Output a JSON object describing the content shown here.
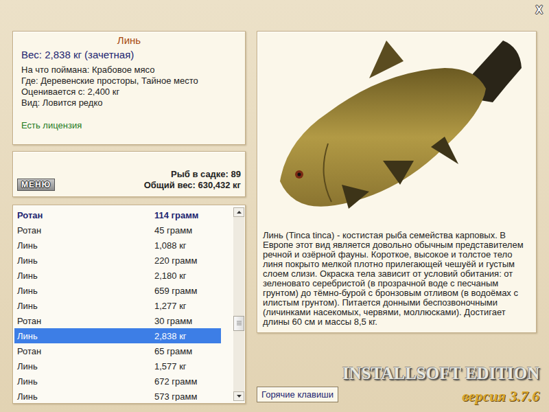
{
  "window": {
    "close": "X"
  },
  "fish": {
    "name": "Линь",
    "weight": "Вес: 2,838 кг (зачетная)",
    "details": [
      "На что поймана: Крабовое мясо",
      "Где: Деревенские просторы, Тайное место",
      "Оценивается с: 2,400 кг",
      "Вид: Ловится редко"
    ],
    "license": "Есть лицензия",
    "description": "Линь (Tinca tinca) - костистая рыба семейства карповых. В Европе этот вид является довольно обычным представителем речной и озёрной фауны. Короткое, высокое и толстое тело линя покрыто мелкой плотно прилегающей чешуёй и густым слоем слизи. Окраска тела зависит от условий обитания: от зеленовато серебристой (в прозрачной воде с песчаным грунтом) до тёмно-бурой с бронзовым отливом (в водоёмах с илистым грунтом). Питается донными беспозвоночными (личинками насекомых, червями, моллюсками). Достигает длины 60 см и массы 8,5 кг."
  },
  "menu_button": "МЕНЮ",
  "keepnet": {
    "count": "Рыб в садке: 89",
    "total": "Общий вес: 630,432 кг"
  },
  "catch_list": {
    "rows": [
      {
        "name": "Ротан",
        "weight": "114 грамм",
        "emphasized": true,
        "selected": false
      },
      {
        "name": "Ротан",
        "weight": "45 грамм",
        "emphasized": false,
        "selected": false
      },
      {
        "name": "Линь",
        "weight": "1,088 кг",
        "emphasized": false,
        "selected": false
      },
      {
        "name": "Линь",
        "weight": "220 грамм",
        "emphasized": false,
        "selected": false
      },
      {
        "name": "Линь",
        "weight": "2,180 кг",
        "emphasized": false,
        "selected": false
      },
      {
        "name": "Линь",
        "weight": "659 грамм",
        "emphasized": false,
        "selected": false
      },
      {
        "name": "Линь",
        "weight": "1,277 кг",
        "emphasized": false,
        "selected": false
      },
      {
        "name": "Ротан",
        "weight": "30 грамм",
        "emphasized": false,
        "selected": false
      },
      {
        "name": "Линь",
        "weight": "2,838 кг",
        "emphasized": false,
        "selected": true
      },
      {
        "name": "Ротан",
        "weight": "65 грамм",
        "emphasized": false,
        "selected": false
      },
      {
        "name": "Линь",
        "weight": "1,577 кг",
        "emphasized": false,
        "selected": false
      },
      {
        "name": "Линь",
        "weight": "672 грамм",
        "emphasized": false,
        "selected": false
      },
      {
        "name": "Линь",
        "weight": "573 грамм",
        "emphasized": false,
        "selected": false
      }
    ],
    "scrollbar": {
      "position": 0.62
    }
  },
  "edition": "INSTALLSOFT EDITION",
  "version": "версия 3.7.6",
  "hotkeys_button": "Горячие клавиши"
}
